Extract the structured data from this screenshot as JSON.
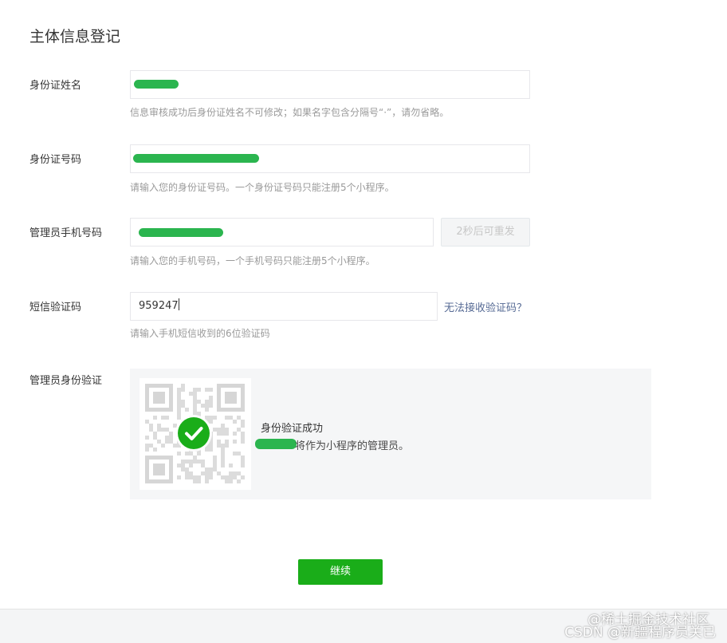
{
  "page": {
    "title": "主体信息登记"
  },
  "form": {
    "id_name": {
      "label": "身份证姓名",
      "value": "",
      "hint": "信息审核成功后身份证姓名不可修改；如果名字包含分隔号“·”，请勿省略。"
    },
    "id_number": {
      "label": "身份证号码",
      "value": "",
      "hint": "请输入您的身份证号码。一个身份证号码只能注册5个小程序。"
    },
    "phone": {
      "label": "管理员手机号码",
      "value": "",
      "resend_label": "2秒后可重发",
      "hint": "请输入您的手机号码，一个手机号码只能注册5个小程序。"
    },
    "sms_code": {
      "label": "短信验证码",
      "value": "959247",
      "help_link": "无法接收验证码？",
      "hint": "请输入手机短信收到的6位验证码"
    },
    "identity_verify": {
      "label": "管理员身份验证",
      "success_title": "身份验证成功",
      "success_desc": "将作为小程序的管理员。"
    }
  },
  "actions": {
    "continue_label": "继续"
  },
  "watermark": {
    "line1": "@稀土掘金技术社区",
    "line2": "CSDN @新疆程序员关已"
  },
  "colors": {
    "brand_green": "#1aad19",
    "link_blue": "#576b95",
    "mask_green": "#2bb54f"
  }
}
